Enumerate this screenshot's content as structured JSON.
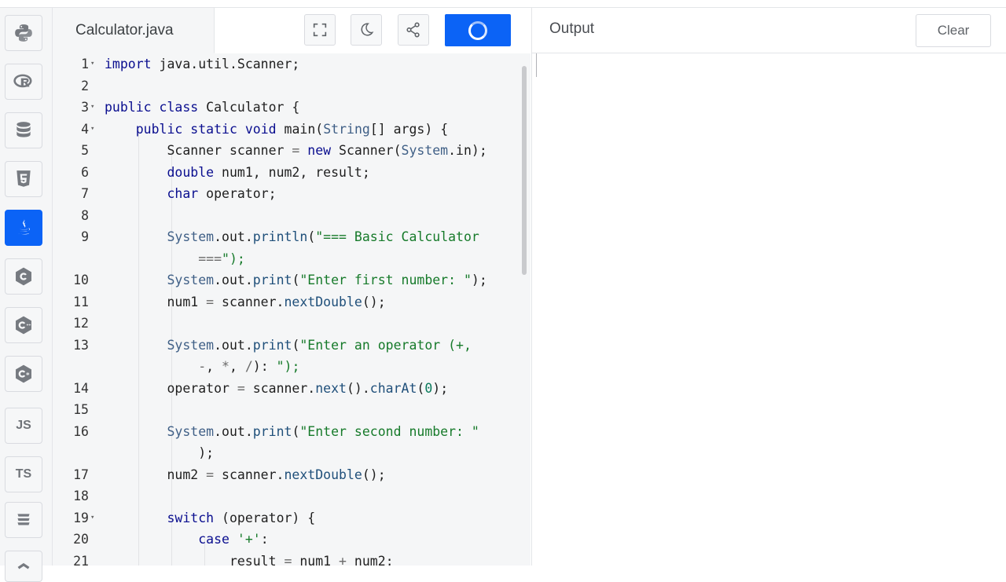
{
  "sidebar": {
    "languages": [
      {
        "name": "python-icon"
      },
      {
        "name": "r-icon"
      },
      {
        "name": "sql-icon"
      },
      {
        "name": "html5-icon"
      },
      {
        "name": "java-icon",
        "active": true
      },
      {
        "name": "c-icon"
      },
      {
        "name": "cpp-icon"
      },
      {
        "name": "csharp-icon"
      },
      {
        "name": "js-icon",
        "label": "JS"
      },
      {
        "name": "ts-icon",
        "label": "TS"
      },
      {
        "name": "stack-icon"
      }
    ]
  },
  "editor": {
    "file_name": "Calculator.java",
    "toolbar": {
      "fullscreen_icon": "fullscreen-icon",
      "theme_icon": "moon-icon",
      "share_icon": "share-icon",
      "run_state": "loading-spinner"
    },
    "lines": [
      {
        "n": "1",
        "code": "import java.util.Scanner;"
      },
      {
        "n": "2",
        "code": ""
      },
      {
        "n": "3",
        "code": "public class Calculator {"
      },
      {
        "n": "4",
        "code": "    public static void main(String[] args) {"
      },
      {
        "n": "5",
        "code": "        Scanner scanner = new Scanner(System.in);"
      },
      {
        "n": "6",
        "code": "        double num1, num2, result;"
      },
      {
        "n": "7",
        "code": "        char operator;"
      },
      {
        "n": "8",
        "code": ""
      },
      {
        "n": "9",
        "code": "        System.out.println(\"=== Basic Calculator\n            ===\");"
      },
      {
        "n": "10",
        "code": "        System.out.print(\"Enter first number: \");"
      },
      {
        "n": "11",
        "code": "        num1 = scanner.nextDouble();"
      },
      {
        "n": "12",
        "code": ""
      },
      {
        "n": "13",
        "code": "        System.out.print(\"Enter an operator (+,\n            -, *, /): \");"
      },
      {
        "n": "14",
        "code": "        operator = scanner.next().charAt(0);"
      },
      {
        "n": "15",
        "code": ""
      },
      {
        "n": "16",
        "code": "        System.out.print(\"Enter second number: \"\n            );"
      },
      {
        "n": "17",
        "code": "        num2 = scanner.nextDouble();"
      },
      {
        "n": "18",
        "code": ""
      },
      {
        "n": "19",
        "code": "        switch (operator) {"
      },
      {
        "n": "20",
        "code": "            case '+':"
      },
      {
        "n": "21",
        "code": "                result = num1 + num2;"
      }
    ]
  },
  "output": {
    "title": "Output",
    "clear_label": "Clear",
    "content": ""
  }
}
